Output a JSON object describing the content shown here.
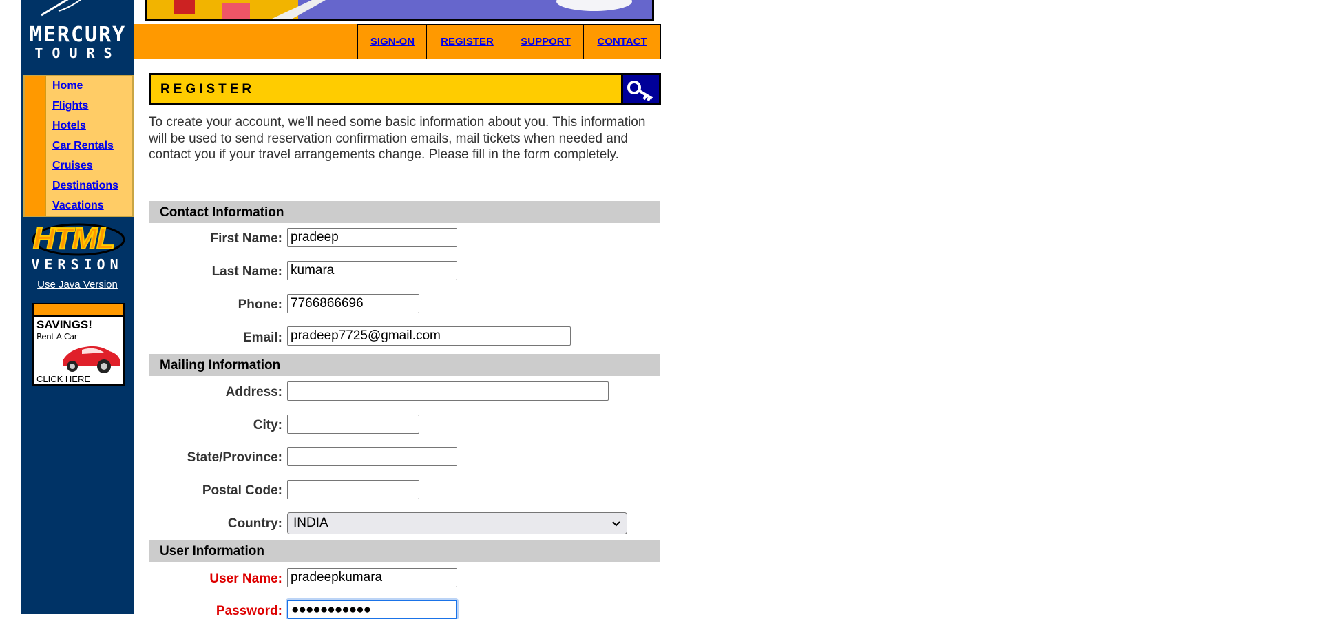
{
  "brand": {
    "line1": "MERCURY",
    "line2": "TOURS"
  },
  "sidebar": {
    "items": [
      {
        "label": "Home"
      },
      {
        "label": "Flights"
      },
      {
        "label": "Hotels"
      },
      {
        "label": "Car Rentals"
      },
      {
        "label": "Cruises"
      },
      {
        "label": "Destinations"
      },
      {
        "label": "Vacations"
      }
    ],
    "html_version": {
      "big": "HTML",
      "small": "VERSION"
    },
    "java_link": "Use Java Version",
    "ad": {
      "title": "SAVINGS!",
      "subtitle": "Rent A Car",
      "cta": "CLICK HERE"
    }
  },
  "topnav": [
    "SIGN-ON",
    "REGISTER",
    "SUPPORT",
    "CONTACT"
  ],
  "page": {
    "title": "REGISTER",
    "intro": "To create your account, we'll need some basic information about you. This information will be used to send reservation confirmation emails, mail tickets when needed and contact you if your travel arrangements change. Please fill in the form completely."
  },
  "contact": {
    "heading": "Contact Information",
    "first_name": {
      "label": "First Name:",
      "value": "pradeep"
    },
    "last_name": {
      "label": "Last Name:",
      "value": "kumara"
    },
    "phone": {
      "label": "Phone:",
      "value": "7766866696"
    },
    "email": {
      "label": "Email:",
      "value": "pradeep7725@gmail.com"
    }
  },
  "mailing": {
    "heading": "Mailing Information",
    "address": {
      "label": "Address:",
      "value": ""
    },
    "city": {
      "label": "City:",
      "value": ""
    },
    "state": {
      "label": "State/Province:",
      "value": ""
    },
    "postal": {
      "label": "Postal Code:",
      "value": ""
    },
    "country": {
      "label": "Country:",
      "value": "INDIA"
    }
  },
  "user": {
    "heading": "User Information",
    "username": {
      "label": "User Name:",
      "value": "pradeepkumara"
    },
    "password": {
      "label": "Password:",
      "value": "●●●●●●●●●●●"
    }
  },
  "colors": {
    "sidebar": "#003366",
    "accent_orange": "#ff9900",
    "title_yellow": "#ffcc00",
    "required_red": "#dd0000",
    "link_blue": "#0000ee"
  }
}
